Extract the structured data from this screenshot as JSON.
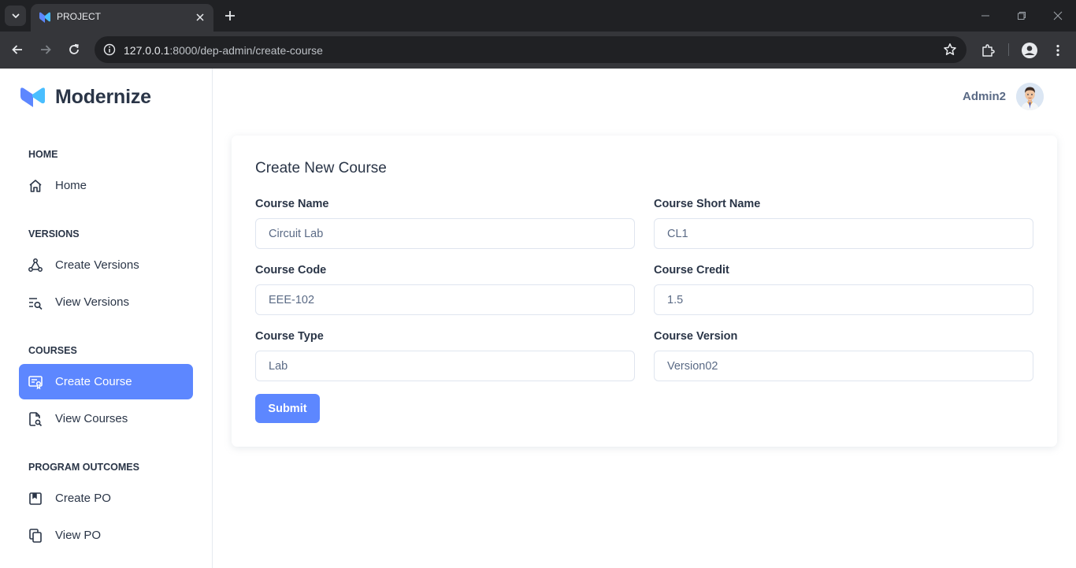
{
  "browser": {
    "tab_title": "PROJECT",
    "url_host": "127.0.0.1",
    "url_path": ":8000/dep-admin/create-course"
  },
  "colors": {
    "primary": "#5d87ff",
    "text_dark": "#2a3547",
    "text_muted": "#5a6a85",
    "border": "#dfe5ef"
  },
  "sidebar": {
    "brand": "Modernize",
    "sections": [
      {
        "title": "HOME",
        "items": [
          {
            "label": "Home",
            "icon": "home-icon"
          }
        ]
      },
      {
        "title": "VERSIONS",
        "items": [
          {
            "label": "Create Versions",
            "icon": "hierarchy-icon"
          },
          {
            "label": "View Versions",
            "icon": "list-search-icon"
          }
        ]
      },
      {
        "title": "COURSES",
        "items": [
          {
            "label": "Create Course",
            "icon": "certificate-icon",
            "active": true
          },
          {
            "label": "View Courses",
            "icon": "file-search-icon"
          }
        ]
      },
      {
        "title": "PROGRAM OUTCOMES",
        "items": [
          {
            "label": "Create PO",
            "icon": "bookmark-icon"
          },
          {
            "label": "View PO",
            "icon": "copy-icon"
          }
        ]
      }
    ]
  },
  "header": {
    "user_name": "Admin2"
  },
  "form": {
    "title": "Create New Course",
    "fields": [
      {
        "label": "Course Name",
        "value": "Circuit Lab"
      },
      {
        "label": "Course Short Name",
        "value": "CL1"
      },
      {
        "label": "Course Code",
        "value": "EEE-102"
      },
      {
        "label": "Course Credit",
        "value": "1.5"
      },
      {
        "label": "Course Type",
        "value": "Lab"
      },
      {
        "label": "Course Version",
        "value": "Version02"
      }
    ],
    "submit_label": "Submit"
  }
}
